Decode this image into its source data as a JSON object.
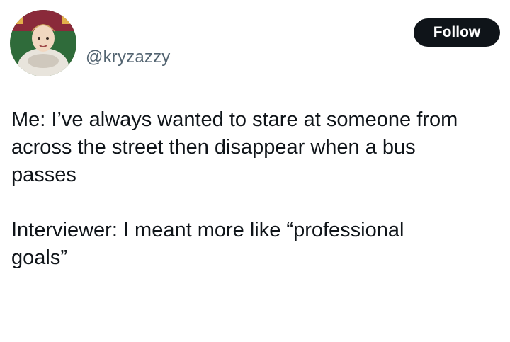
{
  "author": {
    "handle": "@kryzazzy",
    "avatar_icon": "profile-avatar"
  },
  "actions": {
    "follow_label": "Follow"
  },
  "tweet": {
    "paragraphs": [
      "Me: I’ve always wanted to stare at someone from\nacross the street then disappear when a bus\npasses",
      "Interviewer: I meant more like “professional\ngoals”"
    ]
  },
  "colors": {
    "follow_bg": "#0f1419",
    "handle_text": "#536471",
    "body_text": "#0f1419"
  }
}
